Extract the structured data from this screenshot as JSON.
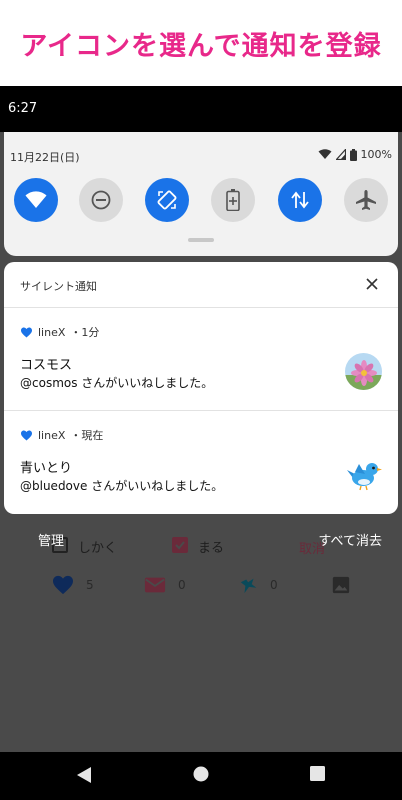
{
  "banner": {
    "text": "アイコンを選んで通知を登録"
  },
  "statusbar": {
    "time": "6:27"
  },
  "quick_settings": {
    "date": "11月22日(日)",
    "battery": "100%",
    "tiles": [
      {
        "icon": "wifi-icon",
        "state": "on"
      },
      {
        "icon": "do-not-disturb-icon",
        "state": "off"
      },
      {
        "icon": "auto-rotate-icon",
        "state": "on"
      },
      {
        "icon": "battery-saver-icon",
        "state": "off"
      },
      {
        "icon": "mobile-data-icon",
        "state": "on"
      },
      {
        "icon": "airplane-mode-icon",
        "state": "off"
      }
    ]
  },
  "notification_card": {
    "header": "サイレント通知",
    "notifications": [
      {
        "app": "lineX",
        "time": "・1分",
        "title": "コスモス",
        "body": "@cosmos さんがいいねしました。",
        "image": "cosmos-flower-avatar"
      },
      {
        "app": "lineX",
        "time": "・現在",
        "title": "青いとり",
        "body": "@bluedove さんがいいねしました。",
        "image": "bluebird-avatar"
      }
    ]
  },
  "footer": {
    "manage": "管理",
    "clear_all": "すべて消去"
  },
  "background_app": {
    "checkbox1_label": "しかく",
    "checkbox2_label": "まる",
    "cancel_label": "取消",
    "counts": {
      "heart": "5",
      "mail": "0",
      "tweet": "0"
    }
  },
  "colors": {
    "accent": "#1a73e8",
    "banner_text": "#e8288a"
  }
}
